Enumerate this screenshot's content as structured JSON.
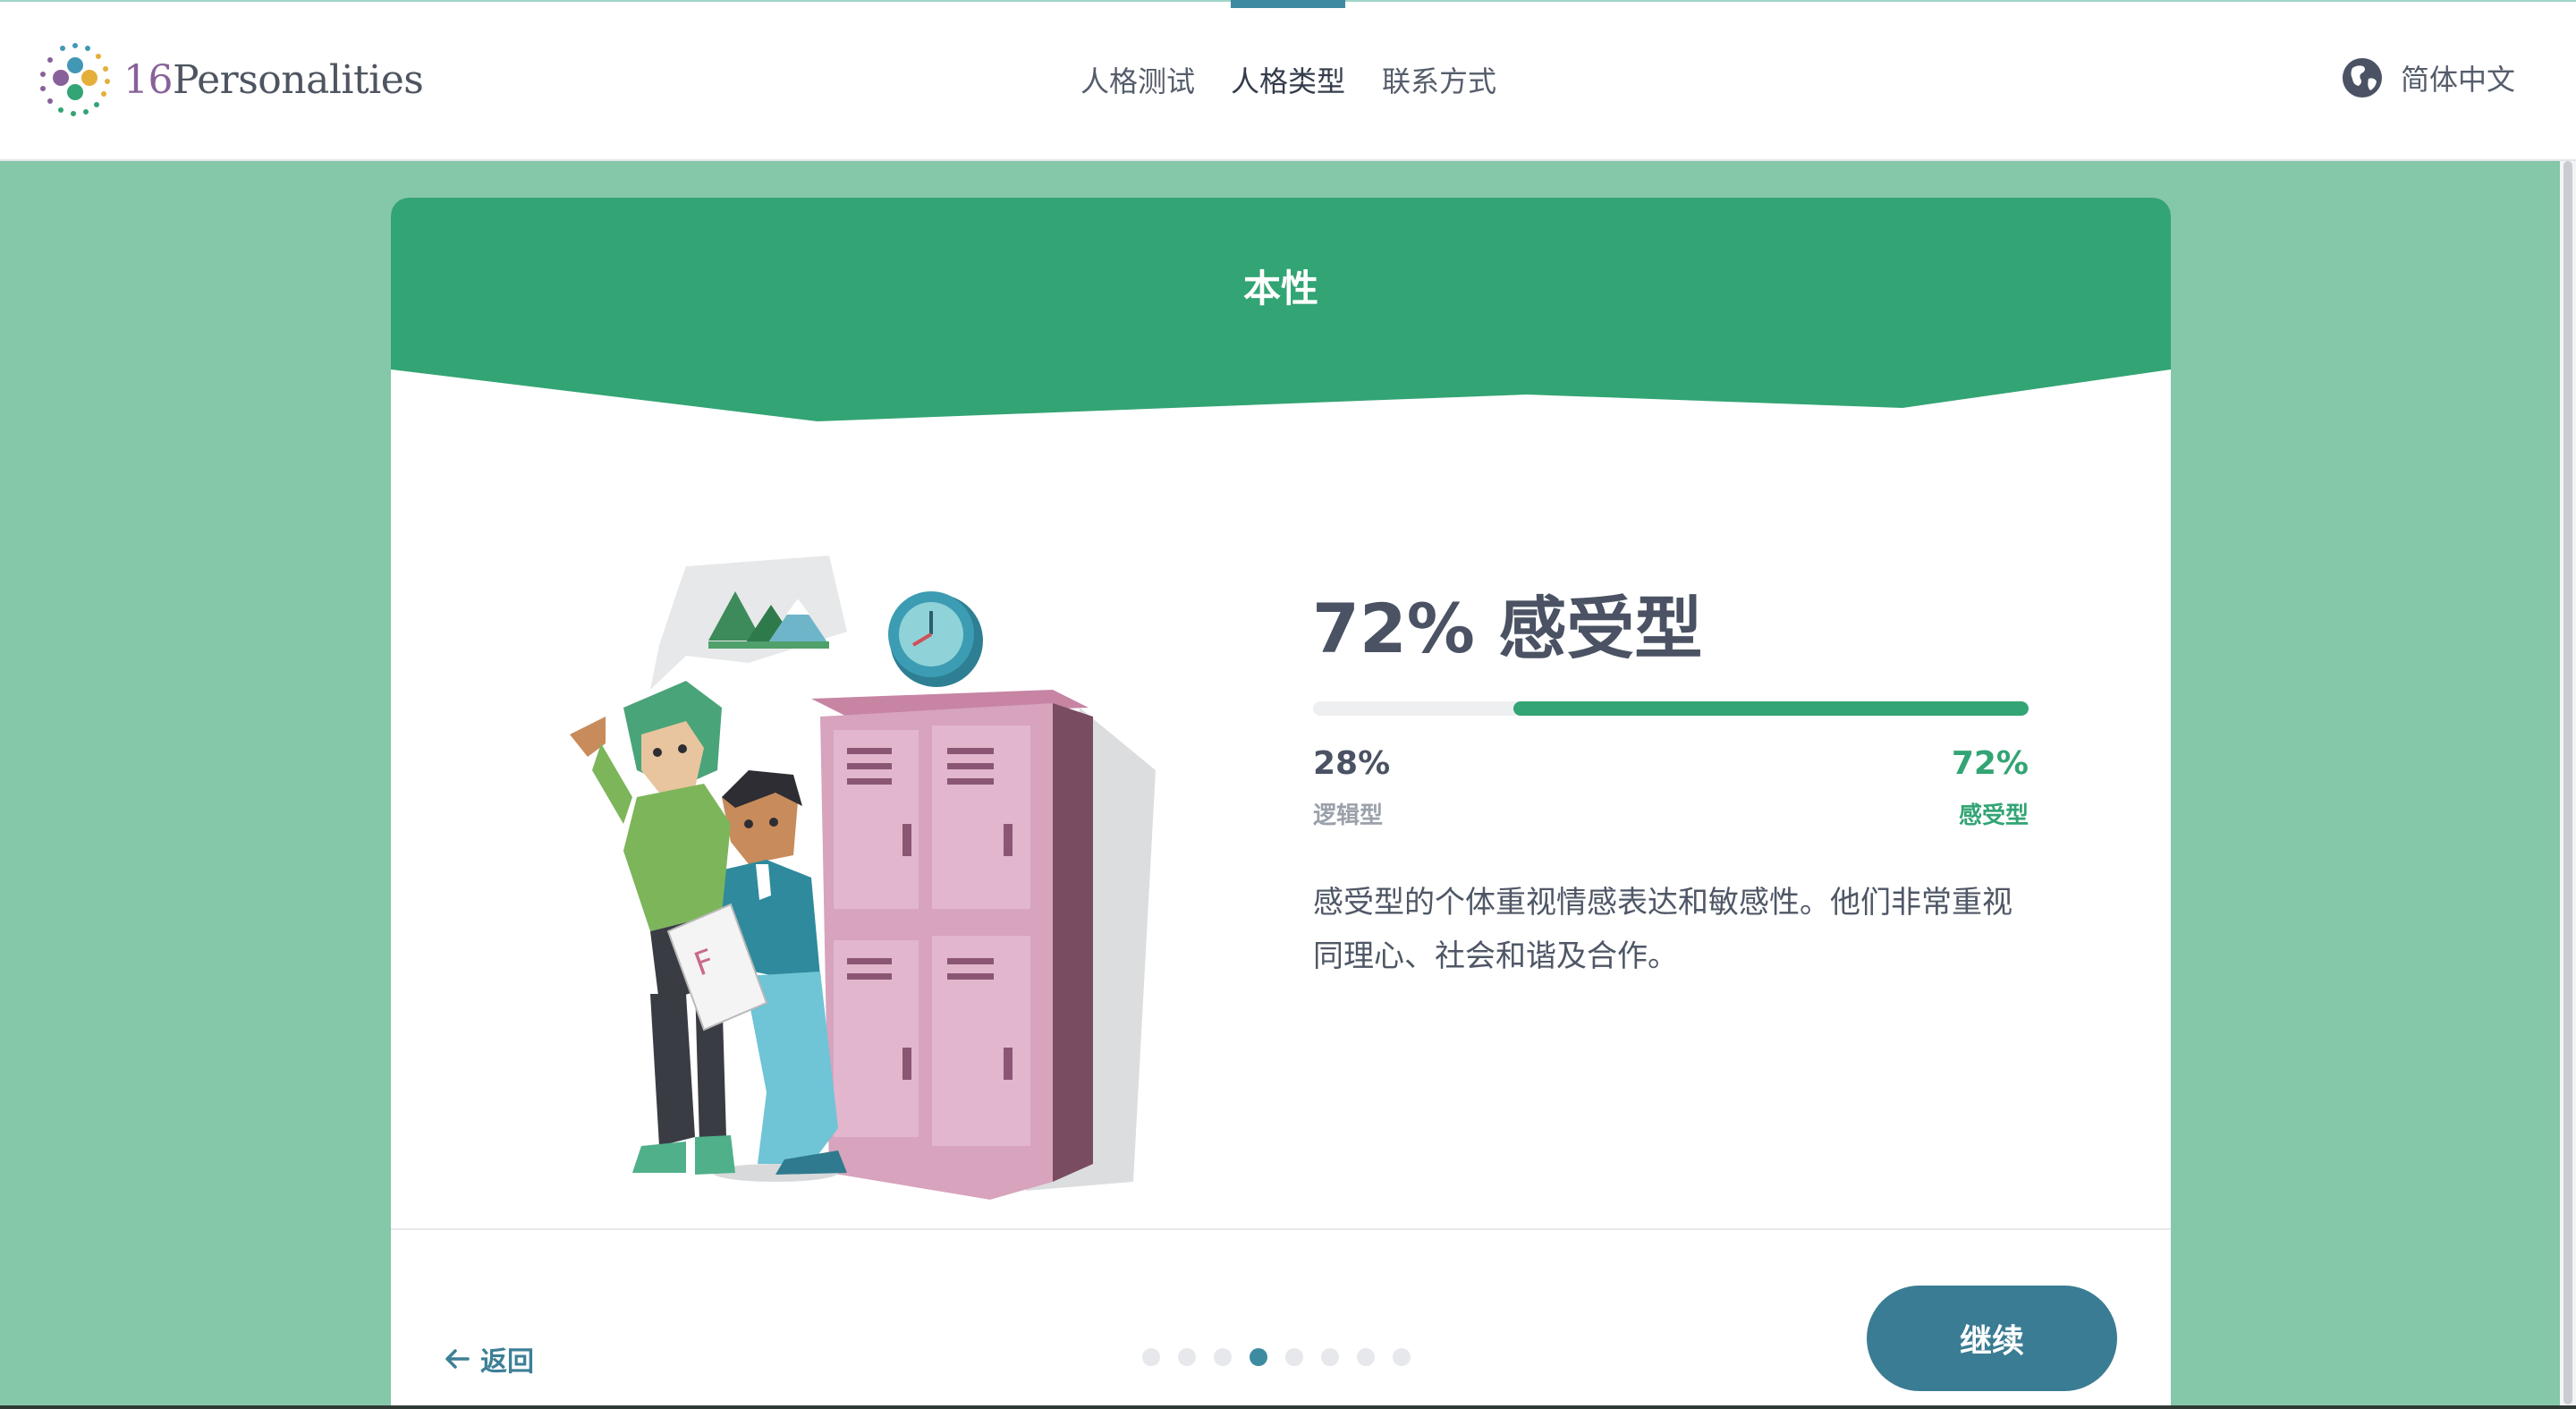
{
  "nav": {
    "logo_number": "16",
    "logo_text": "Personalities",
    "items": [
      {
        "label": "人格测试",
        "active": false
      },
      {
        "label": "人格类型",
        "active": true
      },
      {
        "label": "联系方式",
        "active": false
      }
    ],
    "language": "简体中文",
    "language_icon": "globe-icon"
  },
  "card": {
    "title": "本性",
    "illustration": "lockers-illustration",
    "result_heading": "72% 感受型",
    "progress": {
      "right_fraction": 0.72
    },
    "left": {
      "percent": "28%",
      "label": "逻辑型"
    },
    "right": {
      "percent": "72%",
      "label": "感受型"
    },
    "description": "感受型的个体重视情感表达和敏感性。他们非常重视同理心、社会和谐及合作。"
  },
  "footer": {
    "back_label": "返回",
    "back_icon": "arrow-left-icon",
    "steps_total": 8,
    "step_current": 4,
    "continue_label": "继续"
  },
  "colors": {
    "background": "#85c7a9",
    "header_green": "#33a474",
    "accent_teal": "#3a7c93",
    "text_dark": "#4a5263"
  }
}
